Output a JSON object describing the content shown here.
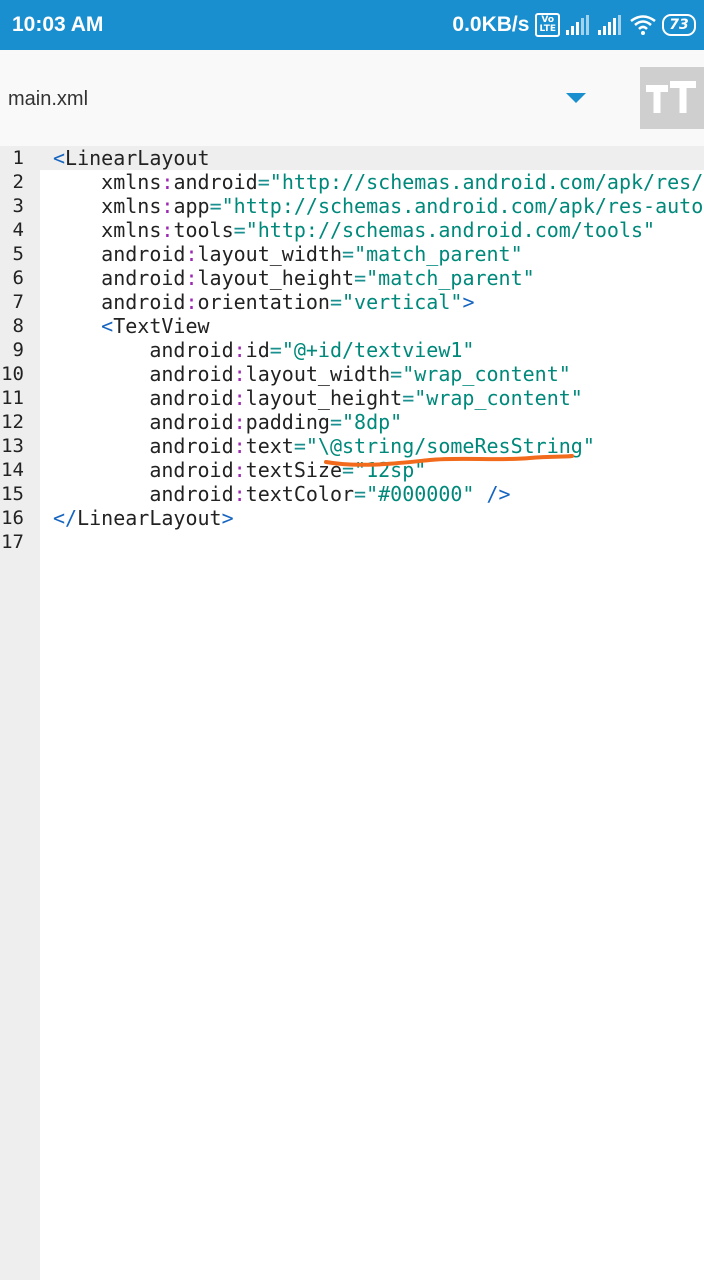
{
  "status_bar": {
    "time": "10:03 AM",
    "net_speed": "0.0KB/s",
    "volte_top": "Vo",
    "volte_bottom": "LTE",
    "battery": "73"
  },
  "toolbar": {
    "file_name": "main.xml",
    "tt_icon_label": "TT"
  },
  "editor": {
    "lines": [
      {
        "n": "1",
        "indent": "",
        "t": [
          [
            "tag",
            "<"
          ],
          [
            "tagname",
            "LinearLayout"
          ]
        ]
      },
      {
        "n": "2",
        "indent": "    ",
        "t": [
          [
            "attr",
            "xmlns"
          ],
          [
            "colon",
            ":"
          ],
          [
            "attr",
            "android"
          ],
          [
            "eq",
            "="
          ],
          [
            "val",
            "\"http://schemas.android.com/apk/res/a"
          ]
        ]
      },
      {
        "n": "3",
        "indent": "    ",
        "t": [
          [
            "attr",
            "xmlns"
          ],
          [
            "colon",
            ":"
          ],
          [
            "attr",
            "app"
          ],
          [
            "eq",
            "="
          ],
          [
            "val",
            "\"http://schemas.android.com/apk/res-auto\""
          ]
        ]
      },
      {
        "n": "4",
        "indent": "    ",
        "t": [
          [
            "attr",
            "xmlns"
          ],
          [
            "colon",
            ":"
          ],
          [
            "attr",
            "tools"
          ],
          [
            "eq",
            "="
          ],
          [
            "val",
            "\"http://schemas.android.com/tools\""
          ]
        ]
      },
      {
        "n": "5",
        "indent": "    ",
        "t": [
          [
            "attr",
            "android"
          ],
          [
            "colon",
            ":"
          ],
          [
            "attr",
            "layout_width"
          ],
          [
            "eq",
            "="
          ],
          [
            "val",
            "\"match_parent\""
          ]
        ]
      },
      {
        "n": "6",
        "indent": "    ",
        "t": [
          [
            "attr",
            "android"
          ],
          [
            "colon",
            ":"
          ],
          [
            "attr",
            "layout_height"
          ],
          [
            "eq",
            "="
          ],
          [
            "val",
            "\"match_parent\""
          ]
        ]
      },
      {
        "n": "7",
        "indent": "    ",
        "t": [
          [
            "attr",
            "android"
          ],
          [
            "colon",
            ":"
          ],
          [
            "attr",
            "orientation"
          ],
          [
            "eq",
            "="
          ],
          [
            "val",
            "\"vertical\""
          ],
          [
            "tag",
            ">"
          ]
        ]
      },
      {
        "n": "8",
        "indent": "    ",
        "t": [
          [
            "tag",
            "<"
          ],
          [
            "tagname",
            "TextView"
          ]
        ]
      },
      {
        "n": "9",
        "indent": "        ",
        "t": [
          [
            "attr",
            "android"
          ],
          [
            "colon",
            ":"
          ],
          [
            "attr",
            "id"
          ],
          [
            "eq",
            "="
          ],
          [
            "val",
            "\"@+id/textview1\""
          ]
        ]
      },
      {
        "n": "10",
        "indent": "        ",
        "t": [
          [
            "attr",
            "android"
          ],
          [
            "colon",
            ":"
          ],
          [
            "attr",
            "layout_width"
          ],
          [
            "eq",
            "="
          ],
          [
            "val",
            "\"wrap_content\""
          ]
        ]
      },
      {
        "n": "11",
        "indent": "        ",
        "t": [
          [
            "attr",
            "android"
          ],
          [
            "colon",
            ":"
          ],
          [
            "attr",
            "layout_height"
          ],
          [
            "eq",
            "="
          ],
          [
            "val",
            "\"wrap_content\""
          ]
        ]
      },
      {
        "n": "12",
        "indent": "        ",
        "t": [
          [
            "attr",
            "android"
          ],
          [
            "colon",
            ":"
          ],
          [
            "attr",
            "padding"
          ],
          [
            "eq",
            "="
          ],
          [
            "val",
            "\"8dp\""
          ]
        ]
      },
      {
        "n": "13",
        "indent": "        ",
        "t": [
          [
            "attr",
            "android"
          ],
          [
            "colon",
            ":"
          ],
          [
            "attr",
            "text"
          ],
          [
            "eq",
            "="
          ],
          [
            "val",
            "\"\\@string/someResString\""
          ]
        ]
      },
      {
        "n": "14",
        "indent": "        ",
        "t": [
          [
            "attr",
            "android"
          ],
          [
            "colon",
            ":"
          ],
          [
            "attr",
            "textSize"
          ],
          [
            "eq",
            "="
          ],
          [
            "val",
            "\"12sp\""
          ]
        ]
      },
      {
        "n": "15",
        "indent": "        ",
        "t": [
          [
            "attr",
            "android"
          ],
          [
            "colon",
            ":"
          ],
          [
            "attr",
            "textColor"
          ],
          [
            "eq",
            "="
          ],
          [
            "val",
            "\"#000000\""
          ],
          [
            "tag",
            " />"
          ]
        ]
      },
      {
        "n": "16",
        "indent": "",
        "t": [
          [
            "tag",
            "</"
          ],
          [
            "tagname",
            "LinearLayout"
          ],
          [
            "tag",
            ">"
          ]
        ]
      },
      {
        "n": "17",
        "indent": "",
        "t": []
      }
    ]
  },
  "colors": {
    "status_bar": "#1a8fcf",
    "annotation_underline": "#f26a1b"
  }
}
